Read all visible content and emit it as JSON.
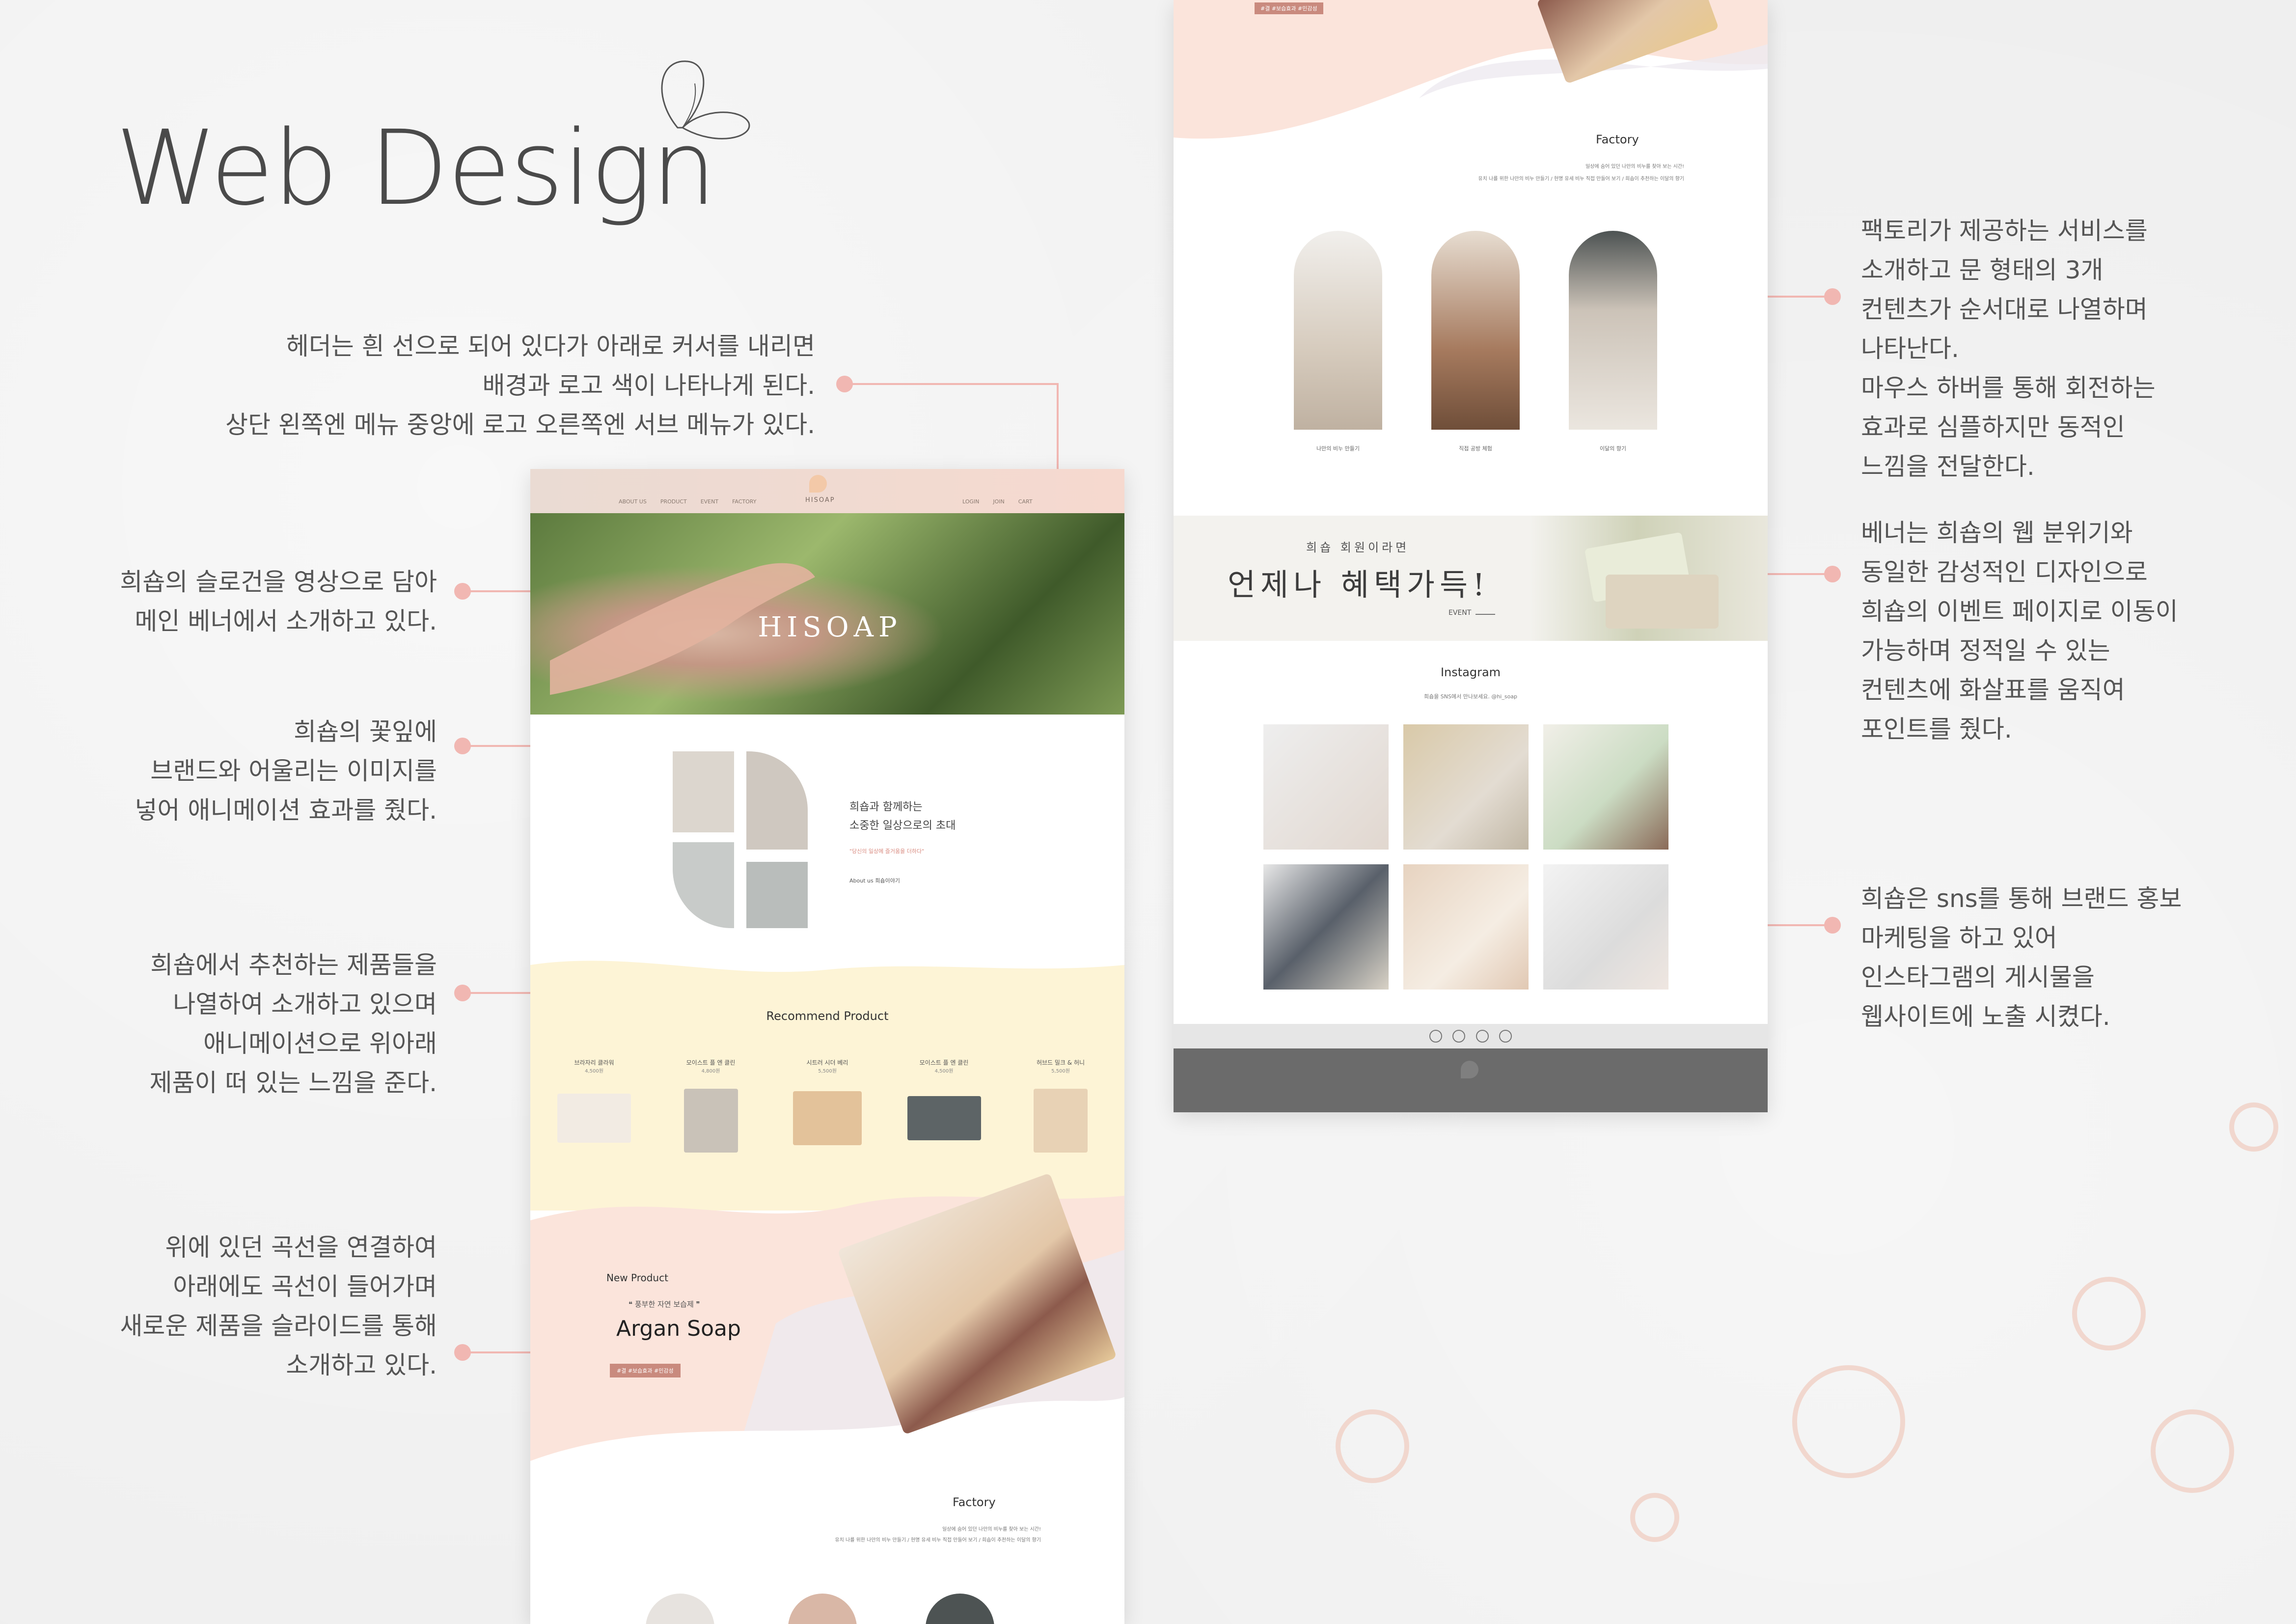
{
  "title": "Web Design",
  "annotations": {
    "header": "헤더는 흰 선으로 되어 있다가 아래로 커서를 내리면\n배경과 로고 색이 나타나게 된다.\n상단 왼쪽엔 메뉴 중앙에 로고 오른쪽엔 서브 메뉴가 있다.",
    "banner": "희숍의 슬로건을 영상으로 담아\n메인 베너에서 소개하고 있다.",
    "petal": "희숍의 꽃잎에\n브랜드와 어울리는 이미지를\n넣어 애니메이션 효과를 줬다.",
    "recommend": "희숍에서 추천하는 제품들을\n나열하여 소개하고 있으며\n애니메이션으로 위아래\n제품이 떠 있는 느낌을 준다.",
    "newproduct": "위에 있던 곡선을 연결하여\n아래에도 곡선이 들어가며\n새로운 제품을 슬라이드를 통해\n소개하고 있다.",
    "factory": "팩토리가 제공하는 서비스를\n소개하고 문 형태의 3개\n컨텐츠가 순서대로 나열하며\n나타난다.\n마우스 하버를 통해 회전하는\n효과로 심플하지만 동적인\n느낌을 전달한다.",
    "event": "베너는 희숍의 웹 분위기와\n동일한 감성적인 디자인으로\n희숍의 이벤트 페이지로 이동이\n가능하며 정적일 수 있는\n컨텐츠에 화살표를 움직여\n포인트를 줬다.",
    "sns": "희숍은 sns를 통해 브랜드 홍보\n마케팅을 하고 있어\n인스타그램의 게시물을\n웹사이트에 노출 시켰다."
  },
  "site": {
    "nav": [
      "ABOUT US",
      "PRODUCT",
      "EVENT",
      "FACTORY"
    ],
    "logo": "HISOAP",
    "subnav": [
      "LOGIN",
      "JOIN",
      "CART"
    ],
    "hero_text": "HISOAP",
    "intro_line1": "희숍과 함께하는",
    "intro_line2": "소중한 일상으로의 초대",
    "intro_quote": "\"당신의 일상에 즐거움을 더하다\"",
    "intro_link": "About us 희숍이야기",
    "recommend_title": "Recommend Product",
    "products": [
      {
        "name": "브라자리 클라워",
        "price": "4,500원"
      },
      {
        "name": "모이스트 플 엔 클린",
        "price": "4,800원"
      },
      {
        "name": "시트러 시더 베리",
        "price": "5,500원"
      },
      {
        "name": "모이스트 플 엔 클린",
        "price": "4,500원"
      },
      {
        "name": "허브드 밀크 & 허니",
        "price": "5,500원"
      }
    ],
    "new_label": "New Product",
    "new_sub": "❝ 풍부한 자연 보습제 ❞",
    "new_name": "Argan Soap",
    "new_tags": "#결 #보습효과 #민감성",
    "factory_title": "Factory",
    "factory_desc1": "일상에 숨어 있던 나만의 비누를 찾아 보는 시간!",
    "factory_desc2": "유치 나를 위한 나만의 비누 만들기 / 현명 유세 비누 직접 만들어 보기 / 희숍이 추천하는 이달의 향기",
    "factory_items": [
      "나만의 비누 만들기",
      "직접 공방 체험",
      "이달의 향기"
    ],
    "event_small": "희숍 회원이라면",
    "event_big": "언제나 혜택가득!",
    "event_link": "EVENT",
    "insta_title": "Instagram",
    "insta_sub": "희숍을 SNS에서 만나보세요. @hi_soap"
  },
  "colors": {
    "accent": "#f1b7b2",
    "pink_bg": "#f9e2da",
    "yellow_bg": "#fdf4d6",
    "tag_bg": "#c98a7e",
    "footer": "#6b6b6b"
  }
}
